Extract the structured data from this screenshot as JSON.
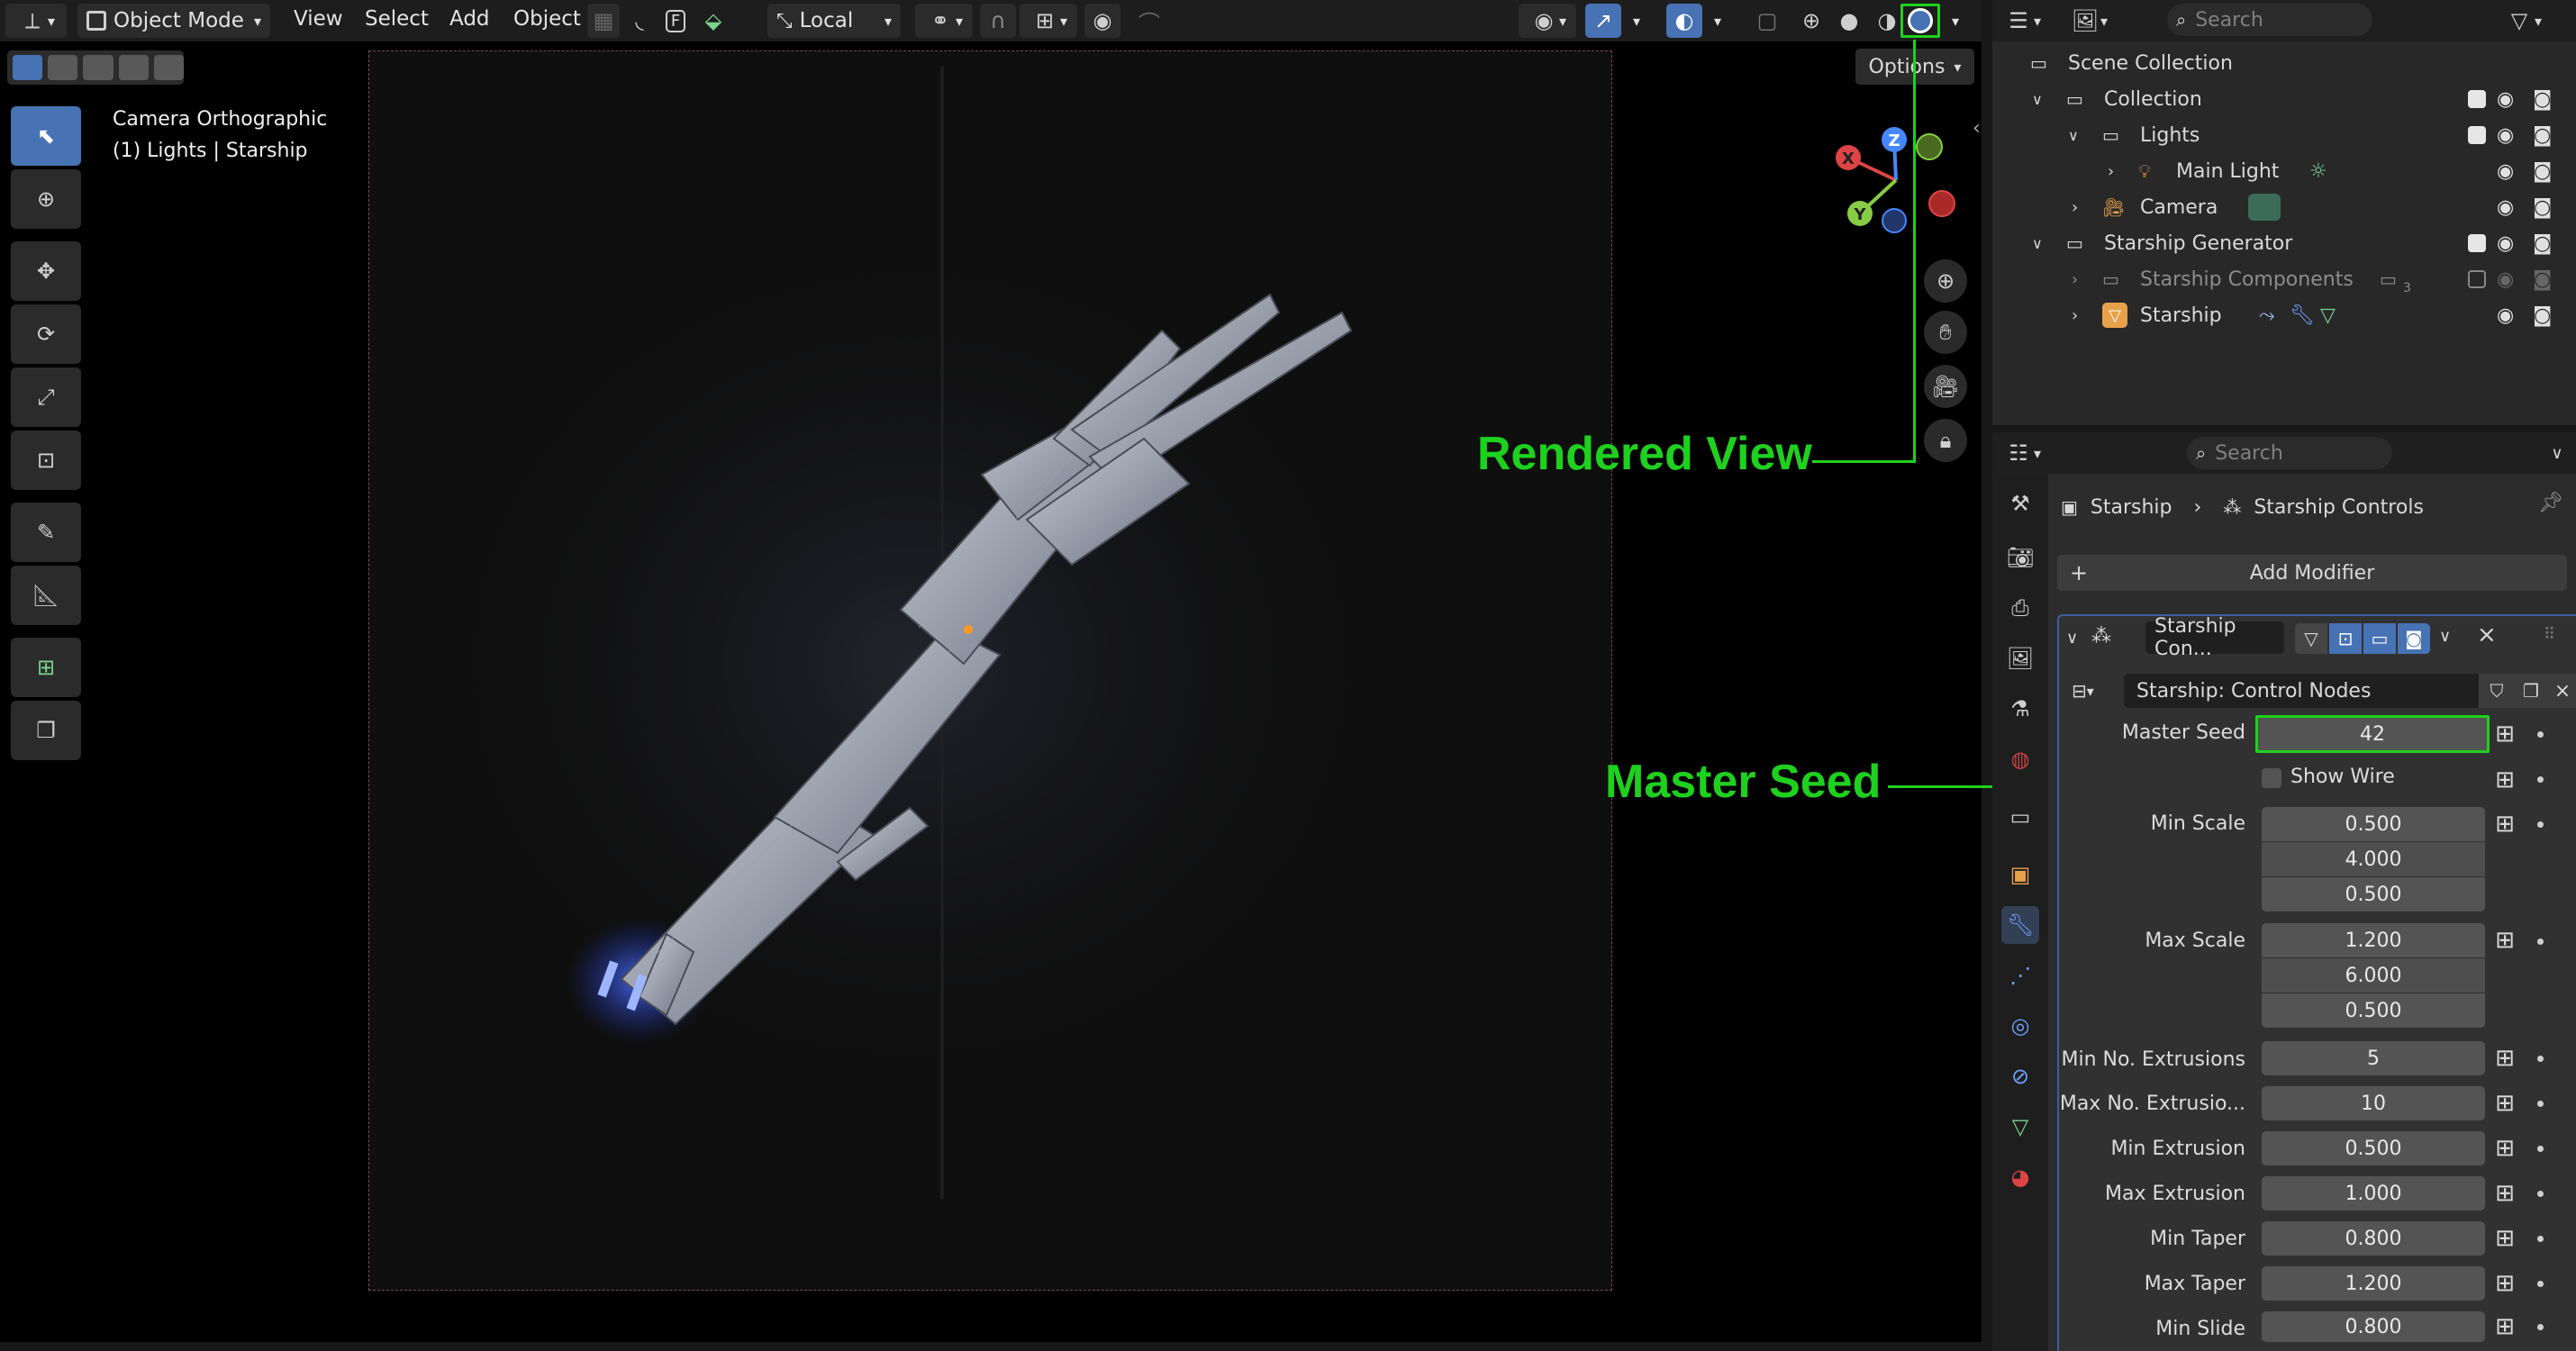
{
  "header": {
    "mode_label": "Object Mode",
    "menus": [
      "View",
      "Select",
      "Add",
      "Object"
    ],
    "transform_orientation": "Local"
  },
  "viewport": {
    "camera_label": "Camera Orthographic",
    "context_label": "(1) Lights | Starship",
    "options_label": "Options",
    "gizmo_axes": [
      "X",
      "Y",
      "Z"
    ]
  },
  "annotations": {
    "rendered_view": "Rendered View",
    "master_seed": "Master Seed"
  },
  "outliner": {
    "search_placeholder": "Search",
    "scene_collection": "Scene Collection",
    "items": [
      {
        "label": "Collection"
      },
      {
        "label": "Lights"
      },
      {
        "label": "Main Light"
      },
      {
        "label": "Camera"
      },
      {
        "label": "Starship Generator"
      },
      {
        "label": "Starship Components",
        "count": "3"
      },
      {
        "label": "Starship"
      }
    ]
  },
  "properties": {
    "search_placeholder": "Search",
    "breadcrumb_object": "Starship",
    "breadcrumb_modifier": "Starship Controls",
    "add_modifier_label": "Add Modifier",
    "modifier_name": "Starship Con...",
    "node_group": "Starship: Control Nodes",
    "fields": {
      "master_seed": {
        "label": "Master Seed",
        "value": "42"
      },
      "show_wire": {
        "label": "Show Wire",
        "checked": false
      },
      "min_scale": {
        "label": "Min Scale",
        "values": [
          "0.500",
          "4.000",
          "0.500"
        ]
      },
      "max_scale": {
        "label": "Max Scale",
        "values": [
          "1.200",
          "6.000",
          "0.500"
        ]
      },
      "min_extrusions": {
        "label": "Min No. Extrusions",
        "value": "5"
      },
      "max_extrusions": {
        "label": "Max No. Extrusio...",
        "value": "10"
      },
      "min_extrusion": {
        "label": "Min Extrusion",
        "value": "0.500"
      },
      "max_extrusion": {
        "label": "Max Extrusion",
        "value": "1.000"
      },
      "min_taper": {
        "label": "Min Taper",
        "value": "0.800"
      },
      "max_taper": {
        "label": "Max Taper",
        "value": "1.200"
      },
      "min_slide": {
        "label": "Min Slide",
        "value": "0.800"
      }
    }
  },
  "colors": {
    "accent": "#4772b3",
    "annotation": "#1fd11f",
    "panel_bg": "#2c2c2c",
    "field_bg": "#545454"
  }
}
